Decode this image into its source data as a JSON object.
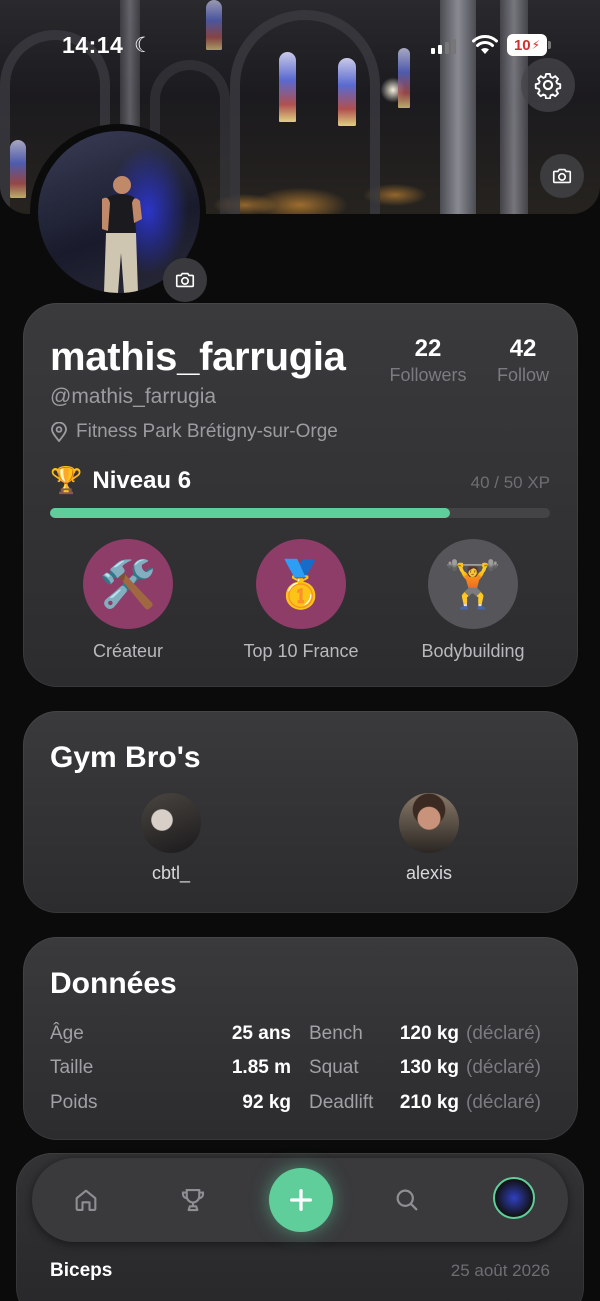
{
  "status": {
    "time": "14:14",
    "battery": "10"
  },
  "profile": {
    "username": "mathis_farrugia",
    "handle": "@mathis_farrugia",
    "location": "Fitness Park Brétigny-sur-Orge",
    "followers_count": "22",
    "followers_label": "Followers",
    "follow_count": "42",
    "follow_label": "Follow",
    "level_label": "Niveau 6",
    "xp_text": "40 / 50 XP",
    "xp_progress": 0.8
  },
  "badges": [
    {
      "name": "Créateur",
      "icon": "hammer-wrench-icon",
      "color": "#8e3c68"
    },
    {
      "name": "Top 10 France",
      "icon": "gold-medal-icon",
      "color": "#8e3c68"
    },
    {
      "name": "Bodybuilding",
      "icon": "weightlifter-icon",
      "color": "#55555a"
    }
  ],
  "gym_bros": {
    "title": "Gym Bro's",
    "items": [
      {
        "name": "cbtl_"
      },
      {
        "name": "alexis"
      }
    ]
  },
  "donnees": {
    "title": "Données",
    "left": [
      {
        "label": "Âge",
        "value": "25 ans"
      },
      {
        "label": "Taille",
        "value": "1.85 m"
      },
      {
        "label": "Poids",
        "value": "92 kg"
      }
    ],
    "right": [
      {
        "label": "Bench",
        "value": "120 kg",
        "note": "(déclaré)"
      },
      {
        "label": "Squat",
        "value": "130 kg",
        "note": "(déclaré)"
      },
      {
        "label": "Deadlift",
        "value": "210 kg",
        "note": "(déclaré)"
      }
    ]
  },
  "nav": {
    "items": [
      "home-icon",
      "trophy-icon",
      "plus-icon",
      "search-icon",
      "profile-avatar"
    ]
  },
  "feed": {
    "title": "Biceps",
    "date": "25 août 2026"
  },
  "colors": {
    "accent": "#5fce9b",
    "badge_pink": "#8e3c68"
  }
}
